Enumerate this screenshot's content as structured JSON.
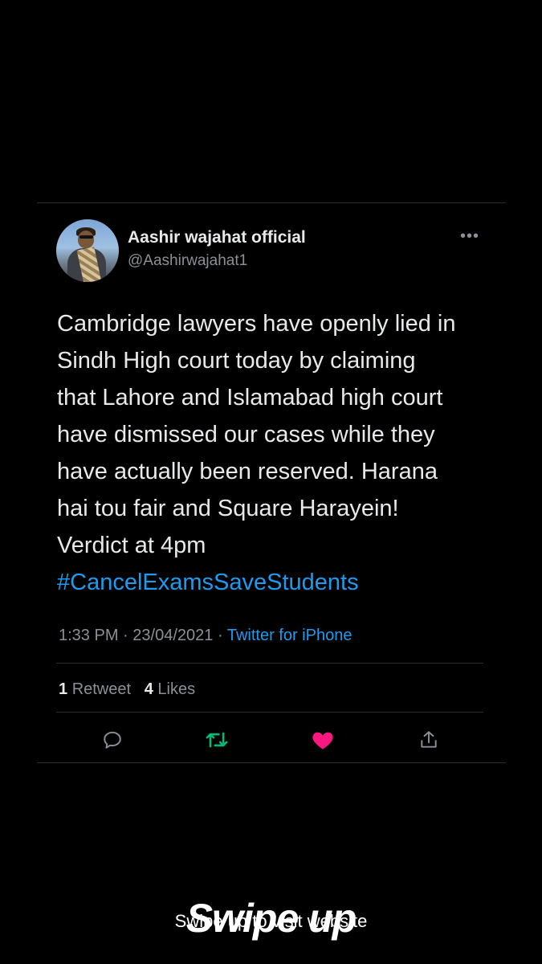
{
  "tweet": {
    "display_name": "Aashir wajahat official",
    "handle": "@Aashirwajahat1",
    "more_icon": "more-icon",
    "body": "Cambridge lawyers have openly lied in\nSindh High court today by claiming\nthat Lahore and Islamabad high court\nhave dismissed our cases while they\nhave actually been reserved. Harana\nhai tou fair and Square Harayein!\nVerdict at 4pm",
    "hashtag": "#CancelExamsSaveStudents",
    "time": "1:33 PM",
    "date": "23/04/2021",
    "separator": "·",
    "source": "Twitter for iPhone",
    "retweet_count": "1",
    "retweet_label": "Retweet",
    "like_count": "4",
    "like_label": "Likes",
    "actions": {
      "reply_icon": "reply-icon",
      "retweet_icon": "retweet-icon",
      "like_icon": "heart-icon",
      "share_icon": "share-icon"
    },
    "colors": {
      "link": "#1d9bf0",
      "retweet": "#00ba7c",
      "like": "#f91880",
      "secondary_text": "#8b9096"
    }
  },
  "overlay": {
    "swipe_text": "Swipe up to visit website",
    "swipe_logo": "Swipe up"
  }
}
